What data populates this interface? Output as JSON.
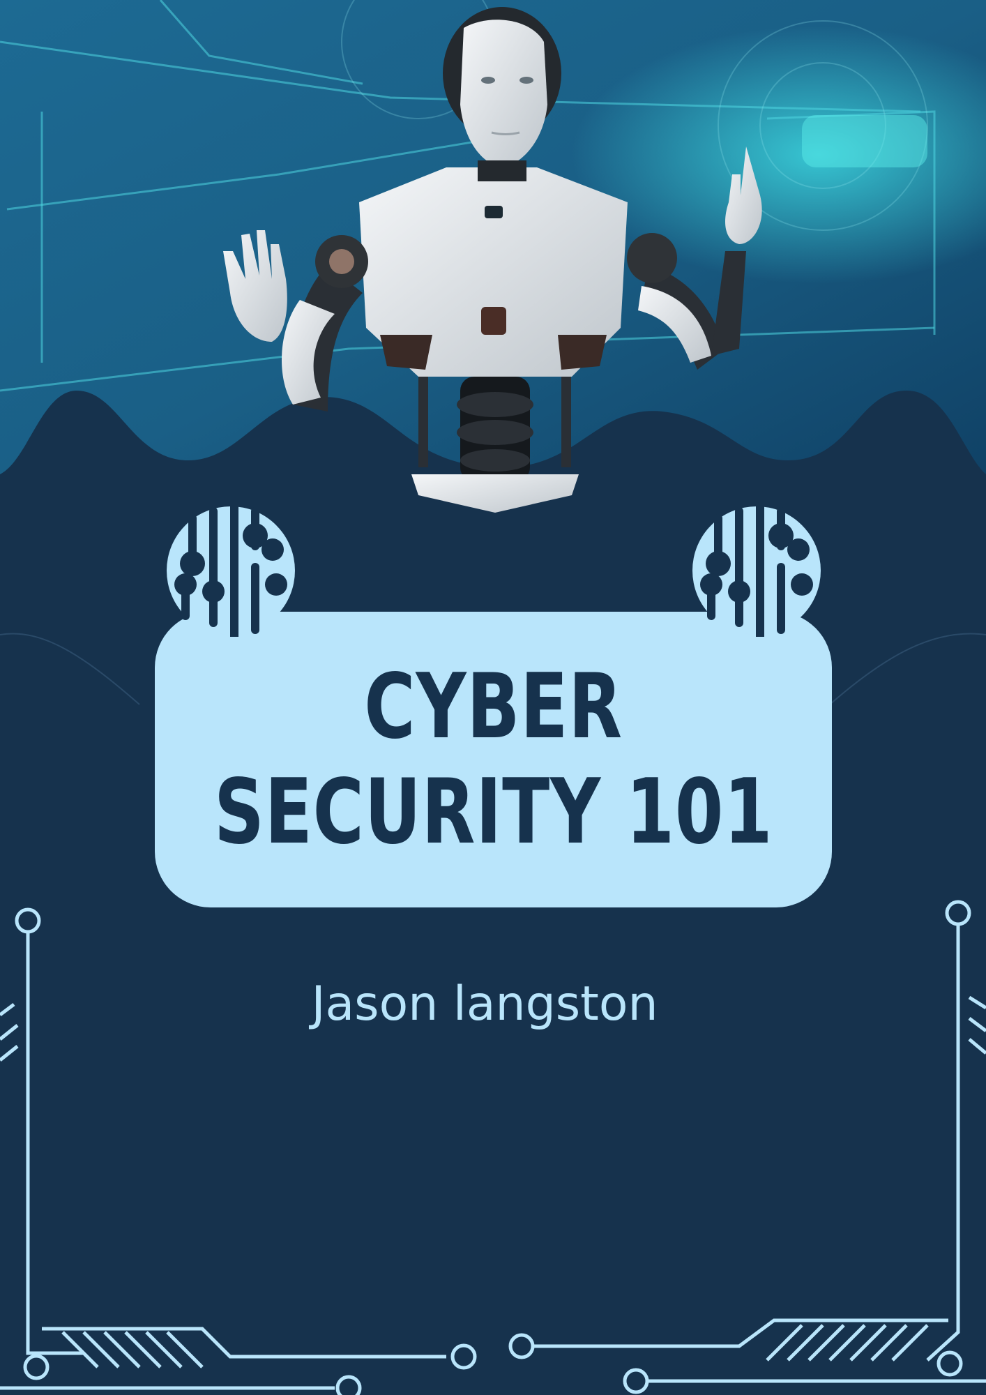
{
  "document": {
    "title_line_1": "CYBER",
    "title_line_2": "SECURITY 101",
    "author": "Jason langston"
  },
  "colors": {
    "background": "#16324d",
    "accent_light": "#b9e5fb",
    "hero_glow": "#35c6d8"
  },
  "icons": [
    "robot-illustration",
    "circuit-chip-icon",
    "circuit-board-border"
  ]
}
